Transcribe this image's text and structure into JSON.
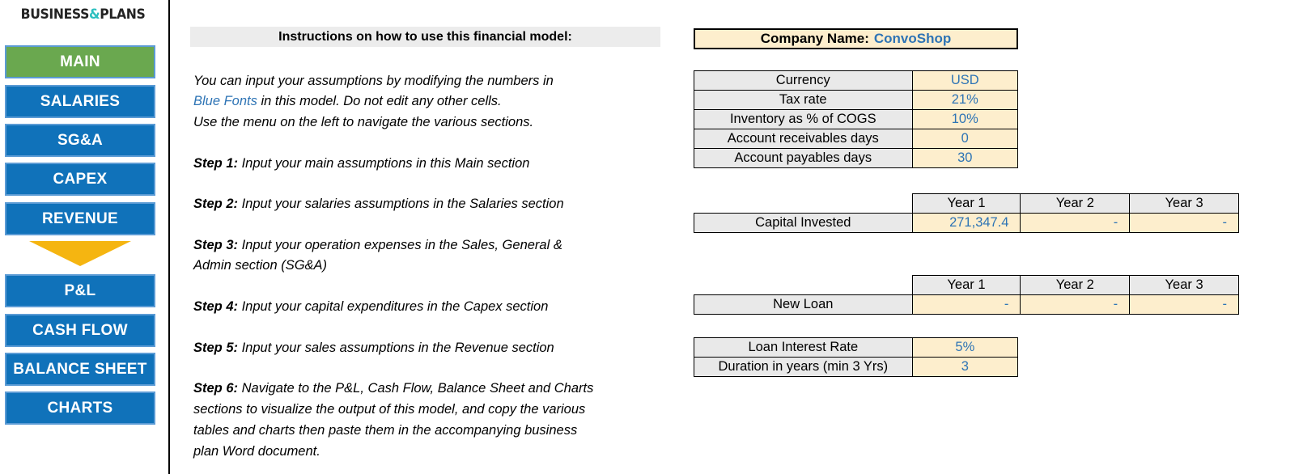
{
  "sidebar": {
    "logo": {
      "pre": "BUSINESS",
      "amp": "&",
      "post": "PLANS"
    },
    "top_items": [
      {
        "label": "MAIN",
        "active": true
      },
      {
        "label": "SALARIES",
        "active": false
      },
      {
        "label": "SG&A",
        "active": false
      },
      {
        "label": "CAPEX",
        "active": false
      },
      {
        "label": "REVENUE",
        "active": false
      }
    ],
    "arrow_icon": "down-arrow-icon",
    "bottom_items": [
      {
        "label": "P&L",
        "active": false
      },
      {
        "label": "CASH FLOW",
        "active": false
      },
      {
        "label": "BALANCE SHEET",
        "active": false
      },
      {
        "label": "CHARTS",
        "active": false
      }
    ]
  },
  "instructions": {
    "header": "Instructions on how to use this financial model:",
    "intro_1_a": "You can input your assumptions by modifying the numbers in",
    "intro_2_blue": "Blue Fonts",
    "intro_2_rest": " in this model. Do not edit any other cells.",
    "intro_3": "Use the menu on the left to navigate the various sections.",
    "steps": [
      {
        "label": "Step 1:",
        "text": " Input your main assumptions in this Main section"
      },
      {
        "label": "Step 2:",
        "text": " Input your salaries assumptions in the Salaries section"
      },
      {
        "label": "Step 3:",
        "text": " Input your operation expenses in the Sales, General &"
      },
      {
        "label": "",
        "text": "Admin section (SG&A)"
      },
      {
        "label": "Step 4:",
        "text": " Input your capital expenditures in the Capex section"
      },
      {
        "label": "Step 5:",
        "text": " Input your sales assumptions in the Revenue section"
      },
      {
        "label": "Step 6:",
        "text": " Navigate to the P&L, Cash Flow, Balance Sheet and Charts"
      },
      {
        "label": "",
        "text": "sections to visualize the output of this model, and copy the various"
      },
      {
        "label": "",
        "text": "tables and charts then paste them in the accompanying business"
      },
      {
        "label": "",
        "text": "plan Word document."
      }
    ]
  },
  "company": {
    "label": "Company Name:",
    "name": "ConvoShop"
  },
  "assumptions": {
    "rows": [
      {
        "label": "Currency",
        "value": "USD"
      },
      {
        "label": "Tax rate",
        "value": "21%"
      },
      {
        "label": "Inventory as % of COGS",
        "value": "10%"
      },
      {
        "label": "Account receivables days",
        "value": "0"
      },
      {
        "label": "Account payables days",
        "value": "30"
      }
    ]
  },
  "capital_table": {
    "year_headers": [
      "Year 1",
      "Year 2",
      "Year 3"
    ],
    "row_label": "Capital Invested",
    "values": [
      "271,347.4",
      "-",
      "-"
    ]
  },
  "loan_table": {
    "year_headers": [
      "Year 1",
      "Year 2",
      "Year 3"
    ],
    "row_label": "New Loan",
    "values": [
      "-",
      "-",
      "-"
    ]
  },
  "loan_terms": {
    "rows": [
      {
        "label": "Loan Interest Rate",
        "value": "5%"
      },
      {
        "label": "Duration in years (min 3 Yrs)",
        "value": "3"
      }
    ]
  },
  "colors": {
    "nav_blue": "#1072ba",
    "nav_active_green": "#6aa84f",
    "nav_border": "#5b9bd5",
    "input_blue_font": "#2e74b5",
    "input_cell_bg": "#fdeecd",
    "label_cell_bg": "#e9e9e9",
    "arrow_amber": "#f5b511",
    "logo_amp_teal": "#2bbfbf"
  }
}
